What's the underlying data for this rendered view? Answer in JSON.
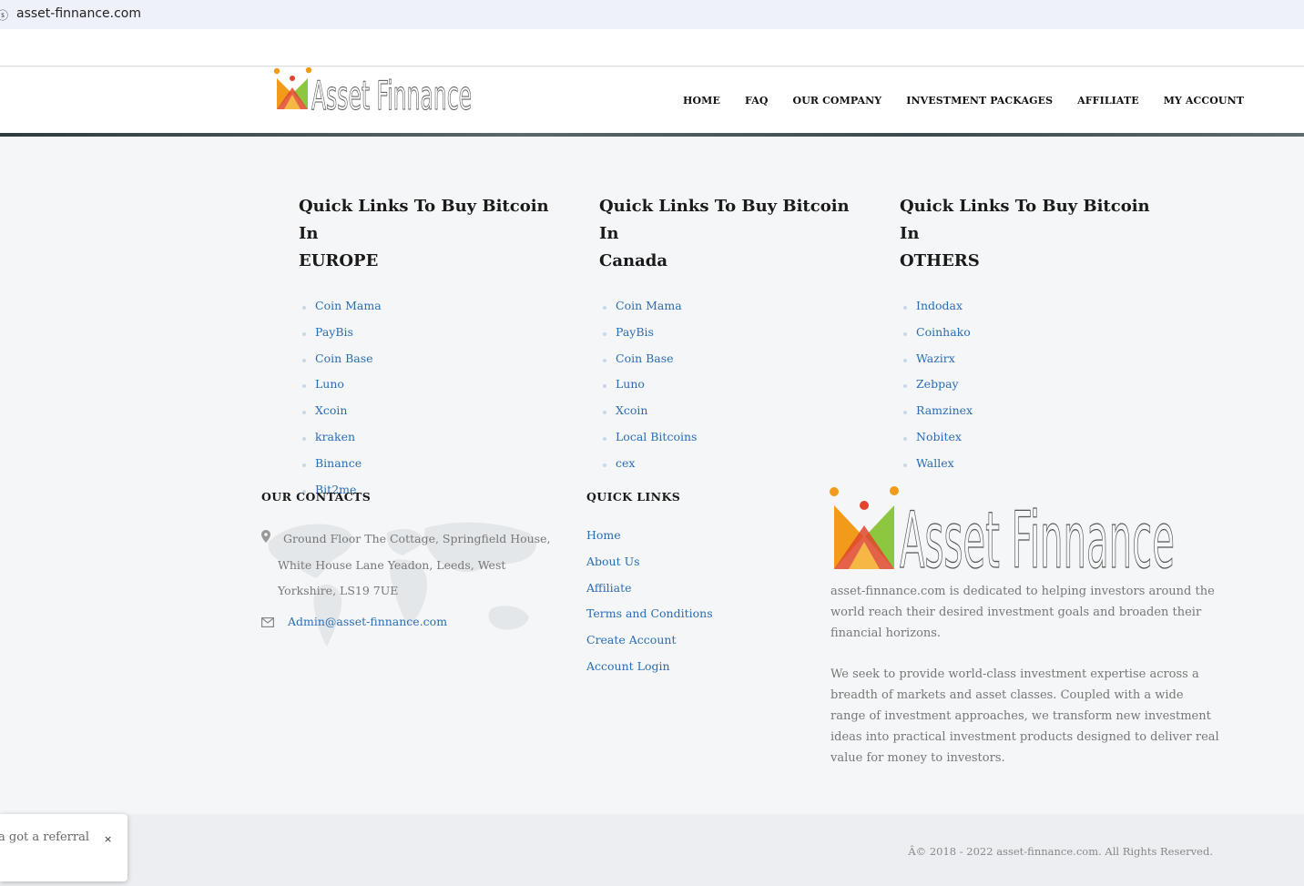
{
  "browser": {
    "url": "asset-finnance.com",
    "site_icon": "ⓢ"
  },
  "header": {
    "logo_text": "Asset Finnance",
    "nav": [
      "HOME",
      "FAQ",
      "OUR COMPANY",
      "INVESTMENT PACKAGES",
      "AFFILIATE",
      "MY ACCOUNT"
    ]
  },
  "quick_columns": [
    {
      "title_line1": "Quick Links To Buy Bitcoin In",
      "title_line2": "EUROPE",
      "links": [
        "Coin Mama",
        "PayBis",
        "Coin Base",
        "Luno",
        "Xcoin",
        "kraken",
        "Binance",
        "Bit2me"
      ]
    },
    {
      "title_line1": "Quick Links To Buy Bitcoin In",
      "title_line2": "Canada",
      "links": [
        "Coin Mama",
        "PayBis",
        "Coin Base",
        "Luno",
        "Xcoin",
        "Local Bitcoins",
        "cex"
      ]
    },
    {
      "title_line1": "Quick Links To Buy Bitcoin In",
      "title_line2": "OTHERS",
      "links": [
        "Indodax",
        "Coinhako",
        "Wazirx",
        "Zebpay",
        "Ramzinex",
        "Nobitex",
        "Wallex"
      ]
    }
  ],
  "contacts": {
    "heading": "OUR CONTACTS",
    "address": "Ground Floor The Cottage, Springfield House, White House Lane Yeadon, Leeds, West Yorkshire, LS19 7UE",
    "email": "Admin@asset-finnance.com"
  },
  "quick_links": {
    "heading": "QUICK LINKS",
    "items": [
      "Home",
      "About Us",
      "Affiliate",
      "Terms and Conditions",
      "Create Account",
      "Account Login"
    ]
  },
  "about": {
    "logo_text": "Asset Finnance",
    "para1": "asset-finnance.com is dedicated to helping investors around the world reach their desired investment goals and broaden their financial horizons.",
    "para2": "We seek to provide world-class investment expertise across a breadth of markets and asset classes. Coupled with a wide range of investment approaches, we transform new investment ideas into practical investment products designed to deliver real value for money to investors."
  },
  "footer": {
    "copyright": "Â© 2018 - 2022 asset-finnance.com. All Rights Reserved."
  },
  "toast": {
    "message": "a got a referral",
    "close": "×"
  },
  "colors": {
    "link": "#2a6db5",
    "logo_orange": "#f29a1a",
    "logo_green": "#8dc63f",
    "logo_red": "#e1462c"
  }
}
